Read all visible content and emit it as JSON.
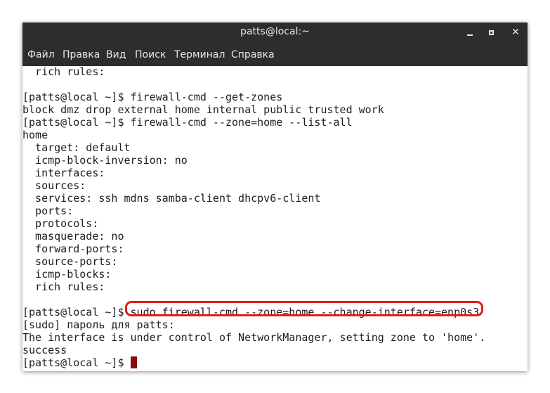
{
  "window": {
    "title": "patts@local:~"
  },
  "menu": {
    "items": [
      "Файл",
      "Правка",
      "Вид",
      "Поиск",
      "Терминал",
      "Справка"
    ]
  },
  "terminal": {
    "lines": [
      "  rich rules:",
      "",
      "[patts@local ~]$ firewall-cmd --get-zones",
      "block dmz drop external home internal public trusted work",
      "[patts@local ~]$ firewall-cmd --zone=home --list-all",
      "home",
      "  target: default",
      "  icmp-block-inversion: no",
      "  interfaces: ",
      "  sources: ",
      "  services: ssh mdns samba-client dhcpv6-client",
      "  ports: ",
      "  protocols: ",
      "  masquerade: no",
      "  forward-ports: ",
      "  source-ports: ",
      "  icmp-blocks: ",
      "  rich rules: ",
      "",
      "[patts@local ~]$ sudo firewall-cmd --zone=home --change-interface=enp0s3",
      "[sudo] пароль для patts: ",
      "The interface is under control of NetworkManager, setting zone to 'home'.",
      "success",
      "[patts@local ~]$ "
    ]
  },
  "highlight_color": "#e21b1b",
  "cursor_color": "#8b0a0a"
}
